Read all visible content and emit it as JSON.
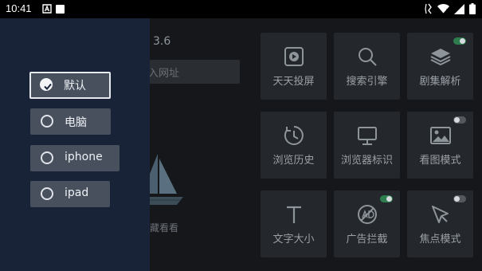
{
  "status_bar": {
    "time": "10:41"
  },
  "background": {
    "version_text": "：3.6",
    "url_placeholder": "入网址",
    "favorites_text": "收藏看看"
  },
  "tiles": [
    {
      "label": "天天投屏",
      "icon": "play-icon"
    },
    {
      "label": "搜索引擎",
      "icon": "search-icon"
    },
    {
      "label": "剧集解析",
      "icon": "layers-icon",
      "toggle": "on"
    },
    {
      "label": "浏览历史",
      "icon": "history-icon"
    },
    {
      "label": "浏览器标识",
      "icon": "monitor-icon"
    },
    {
      "label": "看图模式",
      "icon": "image-icon",
      "toggle": "off"
    },
    {
      "label": "文字大小",
      "icon": "text-size-icon"
    },
    {
      "label": "广告拦截",
      "icon": "ad-block-icon",
      "toggle": "on"
    },
    {
      "label": "焦点模式",
      "icon": "cursor-icon",
      "toggle": "off"
    }
  ],
  "user_agent_menu": {
    "selected": "默认",
    "options": [
      "默认",
      "电脑",
      "iphone",
      "ipad"
    ]
  },
  "colors": {
    "drawer_bg": "#182337",
    "option_bg": "#48505e",
    "tile_bg": "#24272c",
    "toggle_on": "#2e7d4f"
  }
}
